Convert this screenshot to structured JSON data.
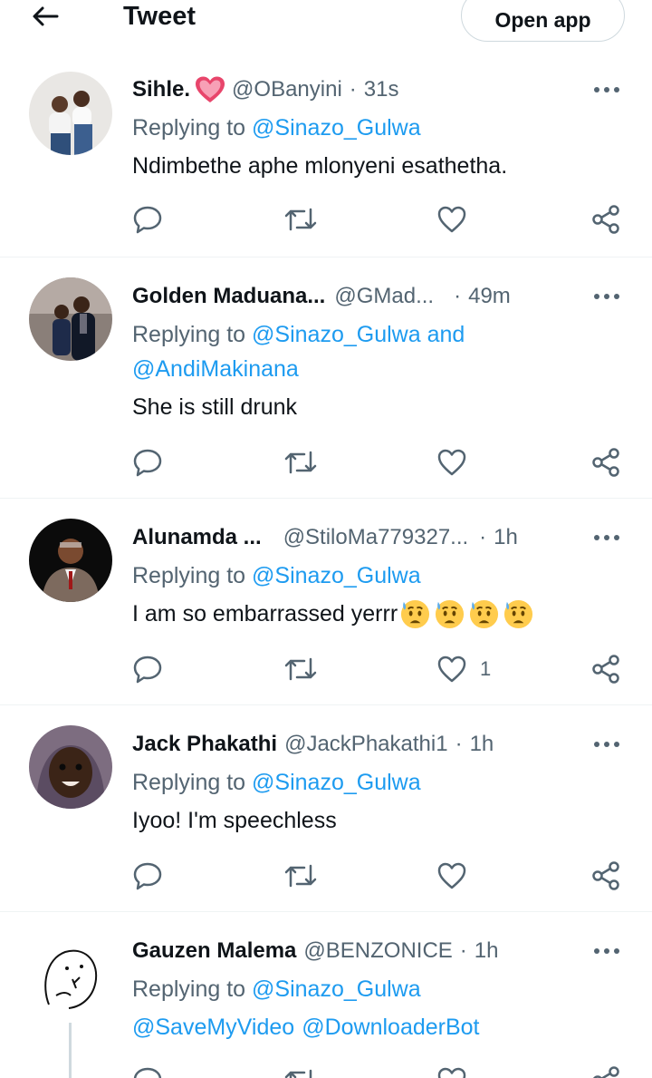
{
  "header": {
    "title": "Tweet",
    "open_app_label": "Open app",
    "back_icon": "arrow-left-icon"
  },
  "labels": {
    "replying_to": "Replying to"
  },
  "colors": {
    "link": "#1d9bf0",
    "muted": "#536471",
    "text": "#0f1419",
    "divider": "#eff3f4"
  },
  "tweets": [
    {
      "name": "Sihle.",
      "name_emoji": "red-heart-icon",
      "handle": "@OBanyini",
      "time": "31s",
      "replying": [
        "@Sinazo_Gulwa"
      ],
      "text": "Ndimbethe aphe mlonyeni esathetha.",
      "likes": ""
    },
    {
      "name": "Golden Maduana...",
      "handle": "@GMad...",
      "time": "49m",
      "replying": [
        "@Sinazo_Gulwa",
        "@AndiMakinana"
      ],
      "replying_joiner": "and",
      "text": "She is still drunk",
      "likes": ""
    },
    {
      "name": "Alunamda ...",
      "handle": "@StiloMa779327...",
      "time": "1h",
      "replying": [
        "@Sinazo_Gulwa"
      ],
      "text": "I am so embarrassed yerrr",
      "text_emojis": [
        "anxious-face-with-sweat-icon",
        "anxious-face-with-sweat-icon",
        "anxious-face-with-sweat-icon",
        "anxious-face-with-sweat-icon"
      ],
      "likes": "1"
    },
    {
      "name": "Jack Phakathi",
      "handle": "@JackPhakathi1",
      "time": "1h",
      "replying": [
        "@Sinazo_Gulwa"
      ],
      "text": "Iyoo! I'm speechless",
      "likes": ""
    },
    {
      "name": "Gauzen Malema",
      "handle": "@BENZONICE",
      "time": "1h",
      "replying": [
        "@Sinazo_Gulwa"
      ],
      "text_links": [
        "@SaveMyVideo",
        "@DownloaderBot"
      ],
      "likes": ""
    }
  ]
}
